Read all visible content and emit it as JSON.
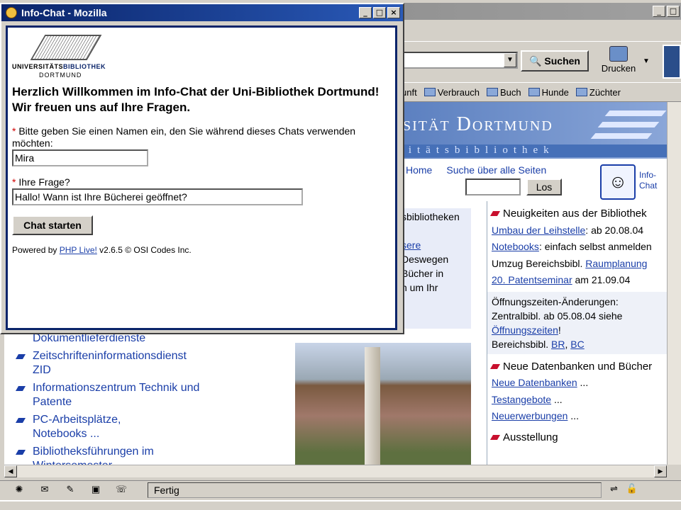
{
  "browser": {
    "toolbar": {
      "search_label": "Suchen",
      "print_label": "Drucken"
    },
    "bookmarks": [
      "unft",
      "Verbrauch",
      "Buch",
      "Hunde",
      "Züchter"
    ],
    "status_text": "Fertig"
  },
  "library_page": {
    "banner_title": "sität Dortmund",
    "banner_subtitle": "sitätsbibliothek",
    "nav": {
      "home": "Home",
      "search_all": "Suche über alle Seiten",
      "search_button": "Los"
    },
    "infochat_label_1": "Info-",
    "infochat_label_2": "Chat",
    "middle_text": [
      "sbibliotheken",
      "",
      "sere",
      "Deswegen",
      "Bücher in",
      "n um Ihr"
    ],
    "left_list": [
      "Dokumentlieferdienste",
      "Zeitschrifteninformationsdienst ZID",
      "Informationszentrum Technik und Patente",
      "PC-Arbeitsplätze, Notebooks ...",
      "Bibliotheksführungen im Wintersemester"
    ],
    "news_heading": "Neuigkeiten aus der Bibliothek",
    "news": [
      {
        "link": "Umbau der Leihstelle",
        "rest": ": ab 20.08.04"
      },
      {
        "link": "Notebooks",
        "rest": ": einfach selbst anmelden"
      },
      {
        "pre": "Umzug Bereichsbibl. ",
        "link": "Raumplanung"
      },
      {
        "link": "20. Patentseminar",
        "rest": " am 21.09.04"
      }
    ],
    "hours_box": {
      "line1": "Öffnungszeiten-Änderungen:",
      "line2": "Zentralbibl. ab 05.08.04 siehe",
      "link": "Öffnungszeiten",
      "line3_pre": "Bereichsbibl. ",
      "br": "BR",
      "bc": "BC"
    },
    "db_heading": "Neue Datenbanken und Bücher",
    "db_links": [
      "Neue Datenbanken",
      "Testangebote",
      "Neuerwerbungen"
    ],
    "ausstellung": "Ausstellung"
  },
  "chat_window": {
    "title": "Info-Chat - Mozilla",
    "logo": {
      "uni_text": "UNIVERSITÄTS",
      "bib_text": "BIBLIOTHEK",
      "city": "DORTMUND"
    },
    "welcome_line1": "Herzlich Willkommen im Info-Chat der Uni-Bibliothek Dortmund!",
    "welcome_line2": "Wir freuen uns auf Ihre Fragen.",
    "name_label": "Bitte geben Sie einen Namen ein, den Sie während dieses Chats verwenden möchten:",
    "name_value": "Mira",
    "question_label": "Ihre Frage?",
    "question_value": "Hallo! Wann ist Ihre Bücherei geöffnet?",
    "start_button": "Chat starten",
    "powered_pre": "Powered by ",
    "powered_link": "PHP Live!",
    "powered_post": " v2.6.5 © OSI Codes Inc."
  }
}
